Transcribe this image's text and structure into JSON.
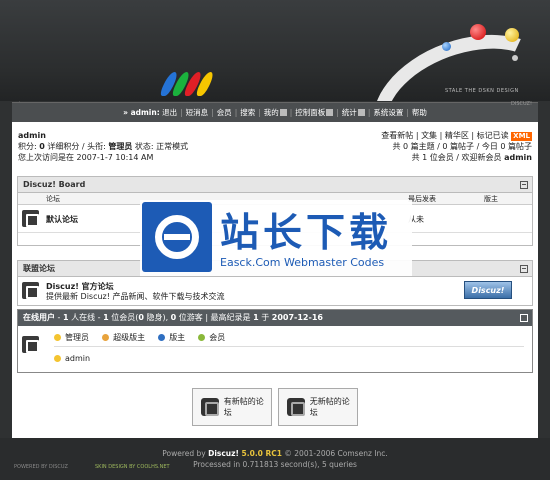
{
  "header": {
    "style_text": "STALE THE DSKN DESIGN",
    "logo_text": "cicty",
    "ver_right": "DISCUZ!"
  },
  "nav": {
    "user": "» admin:",
    "items": [
      "退出",
      "短消息",
      "会员",
      "搜索",
      "我的",
      "控制面板",
      "统计",
      "系统设置",
      "帮助"
    ]
  },
  "user_info": {
    "name": "admin",
    "line1_a": "积分: ",
    "line1_b": "0",
    "line1_c": " 详细积分 / 头衔: ",
    "line1_d": "管理员",
    "line1_e": " 状态: 正常模式",
    "last_visit": "您上次访问是在 2007-1-7 10:14 AM"
  },
  "top_right": {
    "links": [
      "查看新帖",
      "文集",
      "精华区",
      "标记已读"
    ],
    "xml": "XML",
    "stats1": "共 0 篇主题 / 0 篇帖子 / 今日 0 篇帖子",
    "stats2_a": "共 1 位会员 / 欢迎新会员 ",
    "stats2_b": "admin"
  },
  "board": {
    "title": "Discuz! Board",
    "col_forum": "论坛",
    "col_last": "最后发表",
    "col_mod": "版主",
    "forum_name": "默认论坛",
    "last_post": "从未"
  },
  "links": {
    "title": "联盟论坛",
    "name": "Discuz! 官方论坛",
    "desc": "提供最新 Discuz! 产品新闻、软件下载与技术交流",
    "logo_text": "Discuz!"
  },
  "online": {
    "title_a": "在线用户",
    "title_b": " - ",
    "title_c": "1",
    "title_d": " 人在线 - ",
    "title_e": "1",
    "title_f": " 位会员(",
    "title_g": "0",
    "title_h": " 隐身), ",
    "title_i": "0",
    "title_j": " 位游客 | 最高纪录是 ",
    "title_k": "1",
    "title_l": " 于 ",
    "title_m": "2007-12-16",
    "legend": [
      "管理员",
      "超级版主",
      "版主",
      "会员"
    ],
    "user": "admin"
  },
  "buttons": {
    "new_label": "有新帖的论坛",
    "nonew_label": "无新帖的论坛",
    "new_icon": "NEW",
    "nonew_icon": "OLD"
  },
  "watermark": {
    "title": "站长下载",
    "sub": "Easck.Com Webmaster Codes"
  },
  "footer": {
    "line1_a": "Powered by ",
    "line1_b": "Discuz!",
    "line1_c": " 5.0.0 RC1",
    "line1_d": " © 2001-2006 Comsenz Inc.",
    "line2": "Processed in 0.711813 second(s), 5 queries",
    "powered": "POWERED BY DISCUZ",
    "design": "SKIN DESIGN BY COOLHS.NET"
  },
  "colors": {
    "accent_orange": "#f60",
    "brand_blue": "#1d5bb5",
    "version_yellow": "#e8c33c"
  }
}
